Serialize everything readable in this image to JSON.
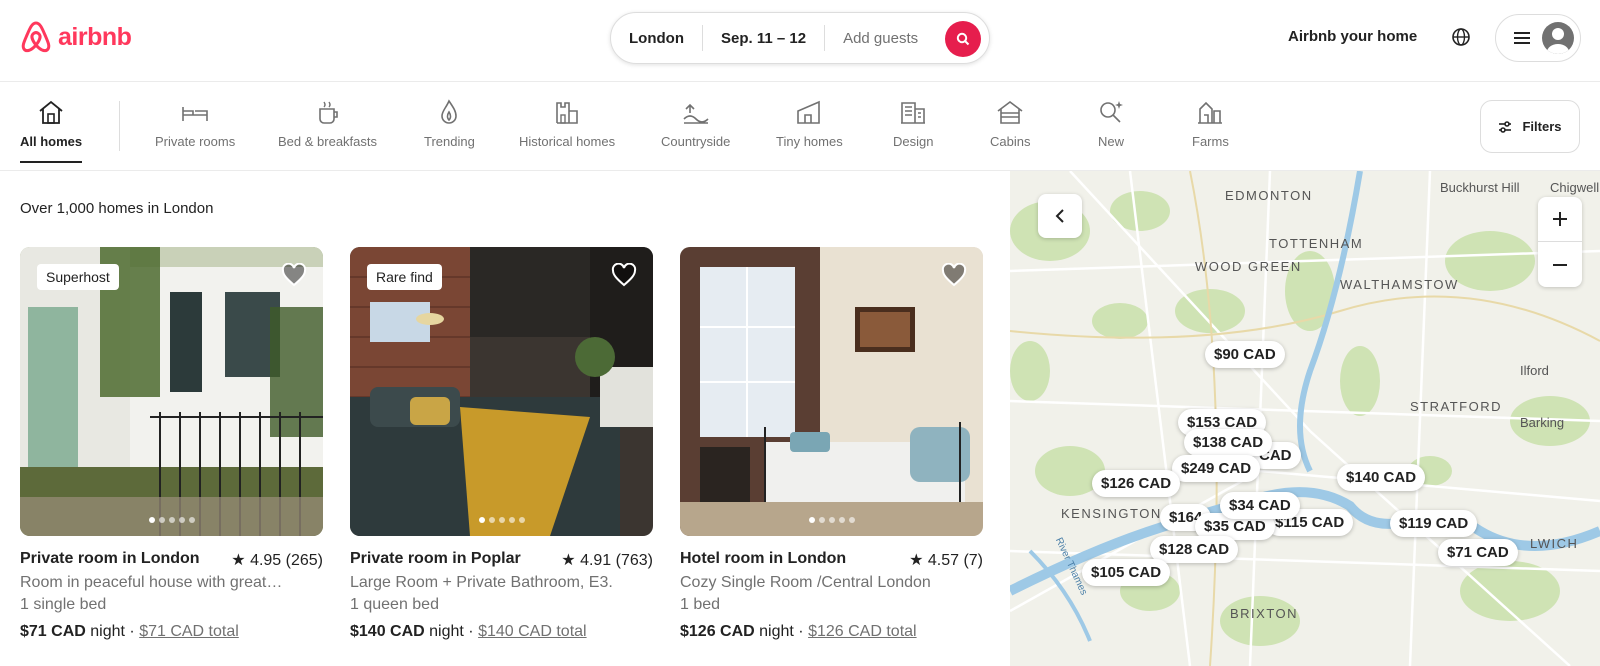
{
  "brand": {
    "name": "airbnb",
    "color": "#FF385C"
  },
  "search": {
    "location": "London",
    "dates": "Sep. 11 – 12",
    "guests_placeholder": "Add guests",
    "icon": "search-icon"
  },
  "header": {
    "host_link": "Airbnb your home",
    "globe_icon": "globe-icon",
    "menu_icon": "hamburger-icon"
  },
  "categories": [
    {
      "label": "All homes",
      "icon": "house-icon",
      "active": true
    },
    {
      "label": "Private rooms",
      "icon": "beds-icon"
    },
    {
      "label": "Bed & breakfasts",
      "icon": "coffee-icon"
    },
    {
      "label": "Trending",
      "icon": "flame-icon"
    },
    {
      "label": "Historical homes",
      "icon": "castle-icon"
    },
    {
      "label": "Countryside",
      "icon": "countryside-icon"
    },
    {
      "label": "Tiny homes",
      "icon": "tiny-home-icon"
    },
    {
      "label": "Design",
      "icon": "design-building-icon"
    },
    {
      "label": "Cabins",
      "icon": "cabin-icon"
    },
    {
      "label": "New",
      "icon": "sparkle-icon"
    },
    {
      "label": "Farms",
      "icon": "farm-icon"
    }
  ],
  "filters": {
    "label": "Filters",
    "icon": "sliders-icon"
  },
  "results": {
    "count_text": "Over 1,000 homes in London"
  },
  "listings": [
    {
      "badge": "Superhost",
      "title": "Private room in London",
      "rating": "4.95 (265)",
      "description": "Room in peaceful house with great…",
      "beds": "1 single bed",
      "price": "$71 CAD",
      "per": "night",
      "total": "$71 CAD total"
    },
    {
      "badge": "Rare find",
      "title": "Private room in Poplar",
      "rating": "4.91 (763)",
      "description": "Large Room + Private Bathroom, E3.",
      "beds": "1 queen bed",
      "price": "$140 CAD",
      "per": "night",
      "total": "$140 CAD total"
    },
    {
      "badge": "",
      "title": "Hotel room in London",
      "rating": "4.57 (7)",
      "description": "Cozy Single Room /Central London",
      "beds": "1 bed",
      "price": "$126 CAD",
      "per": "night",
      "total": "$126 CAD total"
    }
  ],
  "map": {
    "areas": [
      "EDMONTON",
      "Buckhurst Hill",
      "Chigwell",
      "TOTTENHAM",
      "WOOD GREEN",
      "WALTHAMSTOW",
      "Ilford",
      "STRATFORD",
      "Barking",
      "KENSINGTON",
      "BRIXTON",
      "LWICH",
      "River Thames"
    ],
    "pins": [
      "$90 CAD",
      "$153 CAD",
      "$138 CAD",
      "$249 CAD",
      "$126 CAD",
      "$140 CAD",
      "$34 CAD",
      "$164",
      "$35 CAD",
      "$115 CAD",
      "$119 CAD",
      "$71 CAD",
      "$128 CAD",
      "$105 CAD",
      "CAD"
    ]
  }
}
